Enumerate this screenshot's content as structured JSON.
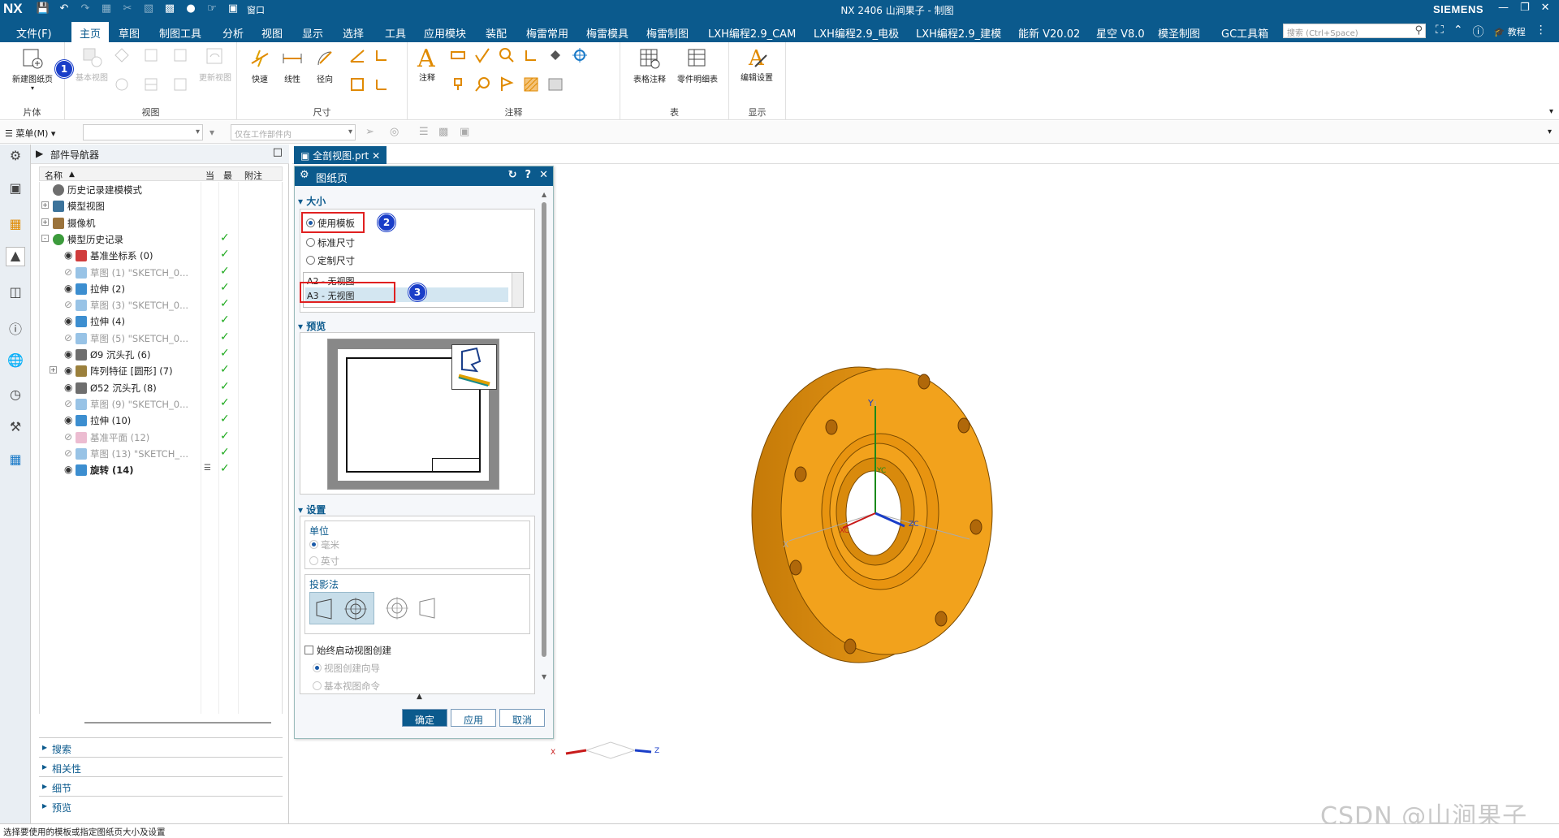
{
  "titlebar": {
    "logo": "NX",
    "window_title": "NX 2406 山涧果子 - 制图",
    "brand": "SIEMENS",
    "quick_access_icons": [
      "save-icon",
      "undo-icon",
      "redo-icon",
      "copy-icon",
      "cut-icon",
      "paste-icon",
      "snap-icon",
      "mic-icon",
      "touch-icon",
      "window-icon"
    ],
    "window_menu": "窗口"
  },
  "menubar": {
    "items": [
      "文件(F)",
      "主页",
      "草图",
      "制图工具",
      "分析",
      "视图",
      "显示",
      "选择",
      "工具",
      "应用模块",
      "装配",
      "梅雷常用",
      "梅雷模具",
      "梅雷制图",
      "LXH编程2.9_CAM",
      "LXH编程2.9_电极",
      "LXH编程2.9_建模",
      "能新 V20.02",
      "星空 V8.0",
      "模圣制图",
      "GC工具箱"
    ],
    "active": "主页",
    "search_placeholder": "搜索 (Ctrl+Space)",
    "right_label": "教程"
  },
  "ribbon": {
    "groups": [
      {
        "label": "片体",
        "tools": [
          "新建图纸页"
        ]
      },
      {
        "label": "视图",
        "tools": [
          "基本视图",
          "更新视图"
        ]
      },
      {
        "label": "尺寸",
        "tools": [
          "快速",
          "线性",
          "径向"
        ]
      },
      {
        "label": "注释",
        "tools": [
          "注释"
        ]
      },
      {
        "label": "表",
        "tools": [
          "表格注释",
          "零件明细表"
        ]
      },
      {
        "label": "显示",
        "tools": [
          "编辑设置"
        ]
      }
    ]
  },
  "toolbar2": {
    "menu_label": "菜单(M)",
    "filter_value": "",
    "scope_value": "仅在工作部件内"
  },
  "navigator": {
    "title": "部件导航器",
    "columns": [
      "名称",
      "当",
      "最",
      "附注"
    ],
    "rows": [
      {
        "label": "历史记录建模模式",
        "indent": 1,
        "icon": "clock-icon",
        "check": false,
        "gray": false
      },
      {
        "label": "模型视图",
        "indent": 1,
        "icon": "view-icon",
        "check": false,
        "gray": false,
        "expand": "+"
      },
      {
        "label": "摄像机",
        "indent": 1,
        "icon": "camera-icon",
        "check": false,
        "gray": false,
        "expand": "+"
      },
      {
        "label": "模型历史记录",
        "indent": 1,
        "icon": "history-icon",
        "check": true,
        "gray": false,
        "expand": "-"
      },
      {
        "label": "基准坐标系 (0)",
        "indent": 2,
        "icon": "csys-icon",
        "check": true,
        "gray": false
      },
      {
        "label": "草图 (1) \"SKETCH_0...",
        "indent": 2,
        "icon": "sketch-icon",
        "check": true,
        "gray": true
      },
      {
        "label": "拉伸 (2)",
        "indent": 2,
        "icon": "extrude-icon",
        "check": true,
        "gray": false
      },
      {
        "label": "草图 (3) \"SKETCH_0...",
        "indent": 2,
        "icon": "sketch-icon",
        "check": true,
        "gray": true
      },
      {
        "label": "拉伸 (4)",
        "indent": 2,
        "icon": "extrude-icon",
        "check": true,
        "gray": false
      },
      {
        "label": "草图 (5) \"SKETCH_0...",
        "indent": 2,
        "icon": "sketch-icon",
        "check": true,
        "gray": true
      },
      {
        "label": "Ø9 沉头孔 (6)",
        "indent": 2,
        "icon": "hole-icon",
        "check": true,
        "gray": false
      },
      {
        "label": "阵列特征 [圆形] (7)",
        "indent": 2,
        "icon": "pattern-icon",
        "check": true,
        "gray": false,
        "expand": "+"
      },
      {
        "label": "Ø52 沉头孔 (8)",
        "indent": 2,
        "icon": "hole-icon",
        "check": true,
        "gray": false
      },
      {
        "label": "草图 (9) \"SKETCH_0...",
        "indent": 2,
        "icon": "sketch-icon",
        "check": true,
        "gray": true
      },
      {
        "label": "拉伸 (10)",
        "indent": 2,
        "icon": "extrude-icon",
        "check": true,
        "gray": false
      },
      {
        "label": "基准平面 (12)",
        "indent": 2,
        "icon": "plane-icon",
        "check": true,
        "gray": true
      },
      {
        "label": "草图 (13) \"SKETCH_...",
        "indent": 2,
        "icon": "sketch-icon",
        "check": true,
        "gray": true
      },
      {
        "label": "旋转 (14)",
        "indent": 2,
        "icon": "revolve-icon",
        "check": true,
        "gray": false,
        "bold": true
      }
    ],
    "panels": [
      "搜索",
      "相关性",
      "细节",
      "预览"
    ]
  },
  "document_tab": "全剖视图.prt",
  "dialog": {
    "title": "图纸页",
    "size_section": "大小",
    "size_options": [
      {
        "label": "使用模板",
        "selected": true
      },
      {
        "label": "标准尺寸",
        "selected": false
      },
      {
        "label": "定制尺寸",
        "selected": false
      }
    ],
    "templates": [
      "A2 - 无视图",
      "A3 - 无视图"
    ],
    "selected_template": "A3 - 无视图",
    "preview_section": "预览",
    "settings_section": "设置",
    "units_label": "单位",
    "units": [
      "毫米",
      "英寸"
    ],
    "projection_label": "投影法",
    "auto_view_checkbox": "始终启动视图创建",
    "auto_view_options": [
      "视图创建向导",
      "基本视图命令"
    ],
    "buttons": {
      "ok": "确定",
      "apply": "应用",
      "cancel": "取消"
    }
  },
  "markers": [
    "1",
    "2",
    "3"
  ],
  "viewport": {
    "part_color": "#f2a21c",
    "axis_labels": [
      "Y",
      "X",
      "ZC",
      "YC",
      "XC"
    ],
    "triad_labels": [
      "X",
      "Z"
    ]
  },
  "statusbar": "选择要使用的模板或指定图纸页大小及设置",
  "watermark": "CSDN @山涧果子"
}
